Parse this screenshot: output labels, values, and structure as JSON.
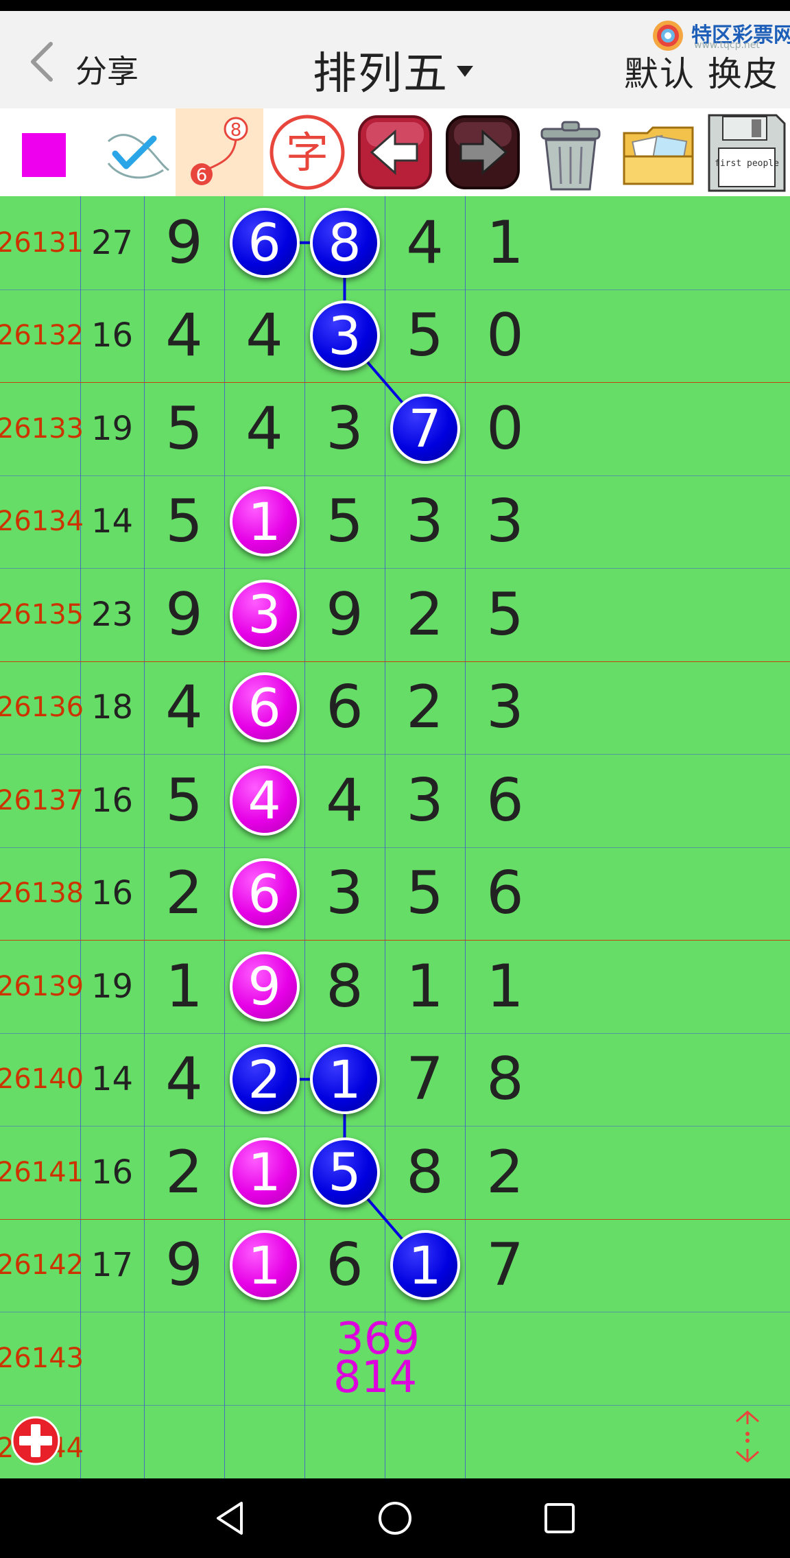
{
  "header": {
    "back_label": "分享",
    "title": "排列五",
    "right_menu": "默认 换皮",
    "brand_name": "特区彩票网",
    "brand_url": "www.tqcp.net"
  },
  "toolbar": {
    "tools": [
      {
        "icon": "magenta-square-icon"
      },
      {
        "icon": "checkmark-pen-icon"
      },
      {
        "icon": "connect-numbers-icon",
        "labels": [
          "8",
          "6"
        ]
      },
      {
        "icon": "character-icon",
        "label": "字"
      },
      {
        "icon": "arrow-left-icon"
      },
      {
        "icon": "arrow-right-icon"
      },
      {
        "icon": "trash-can-icon"
      },
      {
        "icon": "photo-folder-icon"
      },
      {
        "icon": "floppy-disk-icon",
        "label": "first people"
      }
    ],
    "colors": {
      "magenta": "#ee00ee",
      "active_bg": "#ffe6c8"
    }
  },
  "rows": [
    {
      "issue": "26131",
      "sum": "27",
      "d": [
        "9",
        "6",
        "8",
        "4",
        "1"
      ]
    },
    {
      "issue": "26132",
      "sum": "16",
      "d": [
        "4",
        "4",
        "3",
        "5",
        "0"
      ]
    },
    {
      "issue": "26133",
      "sum": "19",
      "d": [
        "5",
        "4",
        "3",
        "7",
        "0"
      ]
    },
    {
      "issue": "26134",
      "sum": "14",
      "d": [
        "5",
        "1",
        "5",
        "3",
        "3"
      ]
    },
    {
      "issue": "26135",
      "sum": "23",
      "d": [
        "9",
        "3",
        "9",
        "2",
        "5"
      ]
    },
    {
      "issue": "26136",
      "sum": "18",
      "d": [
        "4",
        "6",
        "6",
        "2",
        "3"
      ]
    },
    {
      "issue": "26137",
      "sum": "16",
      "d": [
        "5",
        "4",
        "4",
        "3",
        "6"
      ]
    },
    {
      "issue": "26138",
      "sum": "16",
      "d": [
        "2",
        "6",
        "3",
        "5",
        "6"
      ]
    },
    {
      "issue": "26139",
      "sum": "19",
      "d": [
        "1",
        "9",
        "8",
        "1",
        "1"
      ]
    },
    {
      "issue": "26140",
      "sum": "14",
      "d": [
        "4",
        "2",
        "1",
        "7",
        "8"
      ]
    },
    {
      "issue": "26141",
      "sum": "16",
      "d": [
        "2",
        "1",
        "5",
        "8",
        "2"
      ]
    },
    {
      "issue": "26142",
      "sum": "17",
      "d": [
        "9",
        "1",
        "6",
        "1",
        "7"
      ]
    }
  ],
  "highlights": {
    "blue": [
      [
        0,
        1
      ],
      [
        0,
        2
      ],
      [
        1,
        2
      ],
      [
        2,
        3
      ],
      [
        9,
        1
      ],
      [
        9,
        2
      ],
      [
        10,
        2
      ],
      [
        11,
        3
      ]
    ],
    "magenta": [
      [
        3,
        1
      ],
      [
        4,
        1
      ],
      [
        5,
        1
      ],
      [
        6,
        1
      ],
      [
        7,
        1
      ],
      [
        8,
        1
      ],
      [
        10,
        1
      ],
      [
        11,
        1
      ]
    ]
  },
  "next_issue": "26143",
  "next_prediction": [
    "369",
    "814"
  ],
  "partial_issue": "26144",
  "colors": {
    "grid_bg": "#66dd66",
    "issue_text": "#cc3300",
    "blue_ball": "#0000e0",
    "magenta_ball": "#e600e6",
    "prediction_text": "#dd00dd",
    "grid_line": "#3b4bd8",
    "group_line": "#cc3300"
  }
}
